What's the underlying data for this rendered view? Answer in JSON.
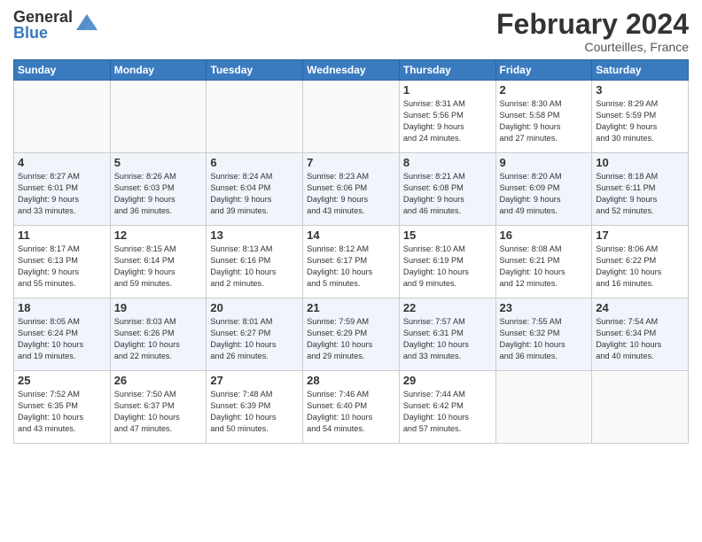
{
  "header": {
    "logo_general": "General",
    "logo_blue": "Blue",
    "month_title": "February 2024",
    "subtitle": "Courteilles, France"
  },
  "days_of_week": [
    "Sunday",
    "Monday",
    "Tuesday",
    "Wednesday",
    "Thursday",
    "Friday",
    "Saturday"
  ],
  "weeks": [
    {
      "alt": false,
      "days": [
        {
          "num": "",
          "info": ""
        },
        {
          "num": "",
          "info": ""
        },
        {
          "num": "",
          "info": ""
        },
        {
          "num": "",
          "info": ""
        },
        {
          "num": "1",
          "info": "Sunrise: 8:31 AM\nSunset: 5:56 PM\nDaylight: 9 hours\nand 24 minutes."
        },
        {
          "num": "2",
          "info": "Sunrise: 8:30 AM\nSunset: 5:58 PM\nDaylight: 9 hours\nand 27 minutes."
        },
        {
          "num": "3",
          "info": "Sunrise: 8:29 AM\nSunset: 5:59 PM\nDaylight: 9 hours\nand 30 minutes."
        }
      ]
    },
    {
      "alt": true,
      "days": [
        {
          "num": "4",
          "info": "Sunrise: 8:27 AM\nSunset: 6:01 PM\nDaylight: 9 hours\nand 33 minutes."
        },
        {
          "num": "5",
          "info": "Sunrise: 8:26 AM\nSunset: 6:03 PM\nDaylight: 9 hours\nand 36 minutes."
        },
        {
          "num": "6",
          "info": "Sunrise: 8:24 AM\nSunset: 6:04 PM\nDaylight: 9 hours\nand 39 minutes."
        },
        {
          "num": "7",
          "info": "Sunrise: 8:23 AM\nSunset: 6:06 PM\nDaylight: 9 hours\nand 43 minutes."
        },
        {
          "num": "8",
          "info": "Sunrise: 8:21 AM\nSunset: 6:08 PM\nDaylight: 9 hours\nand 46 minutes."
        },
        {
          "num": "9",
          "info": "Sunrise: 8:20 AM\nSunset: 6:09 PM\nDaylight: 9 hours\nand 49 minutes."
        },
        {
          "num": "10",
          "info": "Sunrise: 8:18 AM\nSunset: 6:11 PM\nDaylight: 9 hours\nand 52 minutes."
        }
      ]
    },
    {
      "alt": false,
      "days": [
        {
          "num": "11",
          "info": "Sunrise: 8:17 AM\nSunset: 6:13 PM\nDaylight: 9 hours\nand 55 minutes."
        },
        {
          "num": "12",
          "info": "Sunrise: 8:15 AM\nSunset: 6:14 PM\nDaylight: 9 hours\nand 59 minutes."
        },
        {
          "num": "13",
          "info": "Sunrise: 8:13 AM\nSunset: 6:16 PM\nDaylight: 10 hours\nand 2 minutes."
        },
        {
          "num": "14",
          "info": "Sunrise: 8:12 AM\nSunset: 6:17 PM\nDaylight: 10 hours\nand 5 minutes."
        },
        {
          "num": "15",
          "info": "Sunrise: 8:10 AM\nSunset: 6:19 PM\nDaylight: 10 hours\nand 9 minutes."
        },
        {
          "num": "16",
          "info": "Sunrise: 8:08 AM\nSunset: 6:21 PM\nDaylight: 10 hours\nand 12 minutes."
        },
        {
          "num": "17",
          "info": "Sunrise: 8:06 AM\nSunset: 6:22 PM\nDaylight: 10 hours\nand 16 minutes."
        }
      ]
    },
    {
      "alt": true,
      "days": [
        {
          "num": "18",
          "info": "Sunrise: 8:05 AM\nSunset: 6:24 PM\nDaylight: 10 hours\nand 19 minutes."
        },
        {
          "num": "19",
          "info": "Sunrise: 8:03 AM\nSunset: 6:26 PM\nDaylight: 10 hours\nand 22 minutes."
        },
        {
          "num": "20",
          "info": "Sunrise: 8:01 AM\nSunset: 6:27 PM\nDaylight: 10 hours\nand 26 minutes."
        },
        {
          "num": "21",
          "info": "Sunrise: 7:59 AM\nSunset: 6:29 PM\nDaylight: 10 hours\nand 29 minutes."
        },
        {
          "num": "22",
          "info": "Sunrise: 7:57 AM\nSunset: 6:31 PM\nDaylight: 10 hours\nand 33 minutes."
        },
        {
          "num": "23",
          "info": "Sunrise: 7:55 AM\nSunset: 6:32 PM\nDaylight: 10 hours\nand 36 minutes."
        },
        {
          "num": "24",
          "info": "Sunrise: 7:54 AM\nSunset: 6:34 PM\nDaylight: 10 hours\nand 40 minutes."
        }
      ]
    },
    {
      "alt": false,
      "days": [
        {
          "num": "25",
          "info": "Sunrise: 7:52 AM\nSunset: 6:35 PM\nDaylight: 10 hours\nand 43 minutes."
        },
        {
          "num": "26",
          "info": "Sunrise: 7:50 AM\nSunset: 6:37 PM\nDaylight: 10 hours\nand 47 minutes."
        },
        {
          "num": "27",
          "info": "Sunrise: 7:48 AM\nSunset: 6:39 PM\nDaylight: 10 hours\nand 50 minutes."
        },
        {
          "num": "28",
          "info": "Sunrise: 7:46 AM\nSunset: 6:40 PM\nDaylight: 10 hours\nand 54 minutes."
        },
        {
          "num": "29",
          "info": "Sunrise: 7:44 AM\nSunset: 6:42 PM\nDaylight: 10 hours\nand 57 minutes."
        },
        {
          "num": "",
          "info": ""
        },
        {
          "num": "",
          "info": ""
        }
      ]
    }
  ]
}
